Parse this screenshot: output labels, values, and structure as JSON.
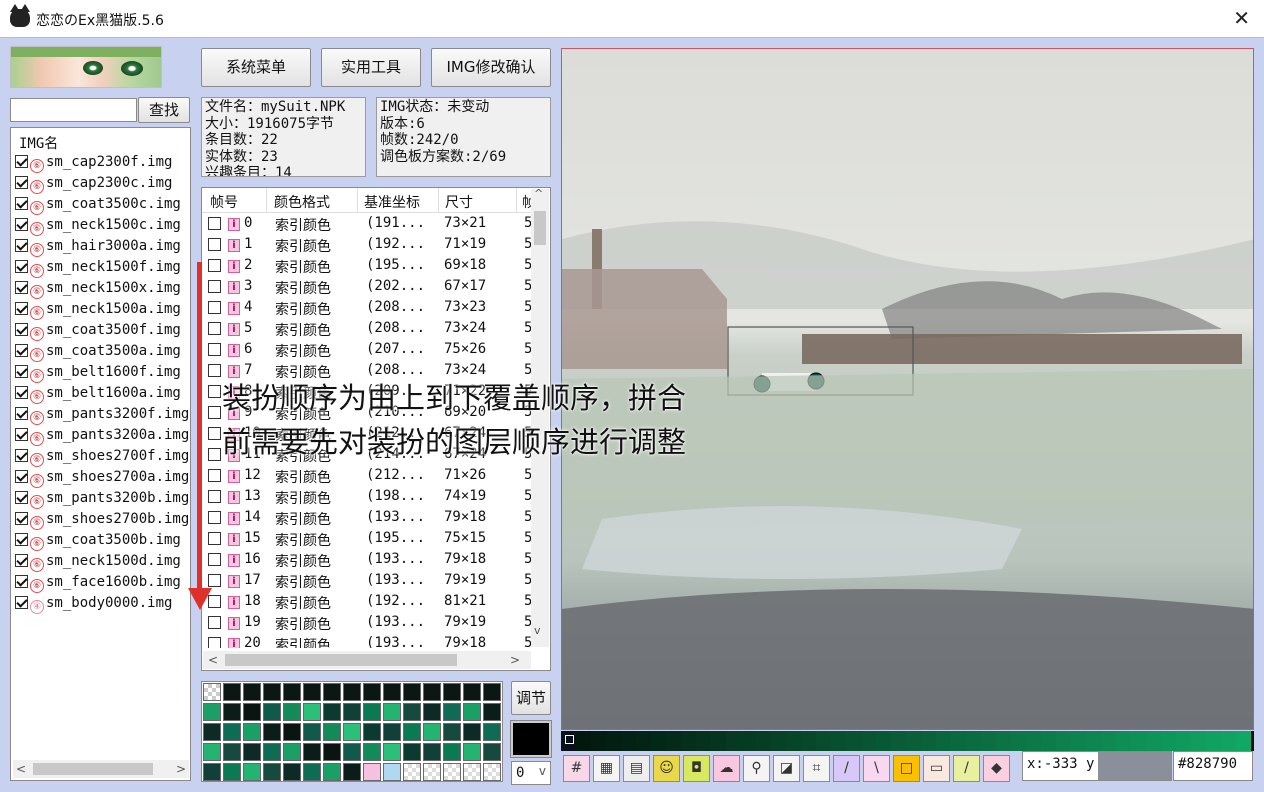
{
  "window": {
    "title": "恋恋のEx黑猫版.5.6",
    "close_glyph": "✕"
  },
  "toolbar": {
    "system_menu": "系统菜单",
    "tools": "实用工具",
    "img_confirm": "IMG修改确认"
  },
  "search": {
    "button": "查找",
    "placeholder": ""
  },
  "file_info": {
    "filename": "文件名：mySuit.NPK",
    "size": "大小：1916075字节",
    "entries": "条目数：22",
    "entities": "实体数：23",
    "fourth": "兴趣条目：14"
  },
  "img_info": {
    "status": "IMG状态：未变动",
    "version": "版本:6",
    "frames": "帧数:242/0",
    "palettes": "调色板方案数:2/69"
  },
  "img_list": {
    "header": "IMG名",
    "items": [
      {
        "name": "sm_cap2300f.img",
        "checked": true,
        "badge": "⑥"
      },
      {
        "name": "sm_cap2300c.img",
        "checked": true,
        "badge": "⑥"
      },
      {
        "name": "sm_coat3500c.img",
        "checked": true,
        "badge": "⑥"
      },
      {
        "name": "sm_neck1500c.img",
        "checked": true,
        "badge": "⑥"
      },
      {
        "name": "sm_hair3000a.img",
        "checked": true,
        "badge": "⑥"
      },
      {
        "name": "sm_neck1500f.img",
        "checked": true,
        "badge": "⑥"
      },
      {
        "name": "sm_neck1500x.img",
        "checked": true,
        "badge": "⑥"
      },
      {
        "name": "sm_neck1500a.img",
        "checked": true,
        "badge": "⑥"
      },
      {
        "name": "sm_coat3500f.img",
        "checked": true,
        "badge": "⑥"
      },
      {
        "name": "sm_coat3500a.img",
        "checked": true,
        "badge": "⑥"
      },
      {
        "name": "sm_belt1600f.img",
        "checked": true,
        "badge": "⑥"
      },
      {
        "name": "sm_belt1600a.img",
        "checked": true,
        "badge": "⑥"
      },
      {
        "name": "sm_pants3200f.img",
        "checked": true,
        "badge": "⑥"
      },
      {
        "name": "sm_pants3200a.img",
        "checked": true,
        "badge": "⑥"
      },
      {
        "name": "sm_shoes2700f.img",
        "checked": true,
        "badge": "⑥"
      },
      {
        "name": "sm_shoes2700a.img",
        "checked": true,
        "badge": "⑥"
      },
      {
        "name": "sm_pants3200b.img",
        "checked": true,
        "badge": "⑥"
      },
      {
        "name": "sm_shoes2700b.img",
        "checked": true,
        "badge": "⑥"
      },
      {
        "name": "sm_coat3500b.img",
        "checked": true,
        "badge": "⑥"
      },
      {
        "name": "sm_neck1500d.img",
        "checked": true,
        "badge": "⑥"
      },
      {
        "name": "sm_face1600b.img",
        "checked": true,
        "badge": "⑥"
      },
      {
        "name": "sm_body0000.img",
        "checked": true,
        "badge": "④"
      }
    ]
  },
  "frame_table": {
    "columns": [
      "帧号",
      "颜色格式",
      "基准坐标",
      "尺寸",
      "帧"
    ],
    "rows": [
      {
        "id": "0",
        "format": "索引颜色",
        "coord": "(191...",
        "size": "73×21",
        "extra": "5"
      },
      {
        "id": "1",
        "format": "索引颜色",
        "coord": "(192...",
        "size": "71×19",
        "extra": "5"
      },
      {
        "id": "2",
        "format": "索引颜色",
        "coord": "(195...",
        "size": "69×18",
        "extra": "5"
      },
      {
        "id": "3",
        "format": "索引颜色",
        "coord": "(202...",
        "size": "67×17",
        "extra": "5"
      },
      {
        "id": "4",
        "format": "索引颜色",
        "coord": "(208...",
        "size": "73×23",
        "extra": "5"
      },
      {
        "id": "5",
        "format": "索引颜色",
        "coord": "(208...",
        "size": "73×24",
        "extra": "5"
      },
      {
        "id": "6",
        "format": "索引颜色",
        "coord": "(207...",
        "size": "75×26",
        "extra": "5"
      },
      {
        "id": "7",
        "format": "索引颜色",
        "coord": "(208...",
        "size": "73×24",
        "extra": "5"
      },
      {
        "id": "8",
        "format": "索引颜色",
        "coord": "(209...",
        "size": "71×22",
        "extra": "5"
      },
      {
        "id": "9",
        "format": "索引颜色",
        "coord": "(210...",
        "size": "69×20",
        "extra": "5"
      },
      {
        "id": "10",
        "format": "索引颜色",
        "coord": "(212...",
        "size": "67×24",
        "extra": "5"
      },
      {
        "id": "11",
        "format": "索引颜色",
        "coord": "(214...",
        "size": "67×24",
        "extra": "5"
      },
      {
        "id": "12",
        "format": "索引颜色",
        "coord": "(212...",
        "size": "71×26",
        "extra": "5"
      },
      {
        "id": "13",
        "format": "索引颜色",
        "coord": "(198...",
        "size": "74×19",
        "extra": "5"
      },
      {
        "id": "14",
        "format": "索引颜色",
        "coord": "(193...",
        "size": "79×18",
        "extra": "5"
      },
      {
        "id": "15",
        "format": "索引颜色",
        "coord": "(195...",
        "size": "75×15",
        "extra": "5"
      },
      {
        "id": "16",
        "format": "索引颜色",
        "coord": "(193...",
        "size": "79×18",
        "extra": "5"
      },
      {
        "id": "17",
        "format": "索引颜色",
        "coord": "(193...",
        "size": "79×19",
        "extra": "5"
      },
      {
        "id": "18",
        "format": "索引颜色",
        "coord": "(192...",
        "size": "81×21",
        "extra": "5"
      },
      {
        "id": "19",
        "format": "索引颜色",
        "coord": "(193...",
        "size": "79×19",
        "extra": "5"
      },
      {
        "id": "20",
        "format": "索引颜色",
        "coord": "(193...",
        "size": "79×18",
        "extra": "5"
      }
    ]
  },
  "palette_panel": {
    "adjust_button": "调节",
    "combo_value": "0",
    "swatch_color": "#000000"
  },
  "annotation": {
    "line1": "装扮顺序为由上到下覆盖顺序，拼合",
    "line2": "前需要先对装扮的图层顺序进行调整"
  },
  "status": {
    "x_label": "x:-333 y",
    "hex": "#828790"
  },
  "tools": [
    "grid-tool-icon",
    "palette-tool-icon",
    "film-tool-icon",
    "frog-tool-icon",
    "camera-tool-icon",
    "cloud-tool-icon",
    "magnifier-tool-icon",
    "layers-tool-icon",
    "crop-tool-icon",
    "pencil-tool-icon",
    "line-tool-icon",
    "rect-tool-icon",
    "eraser-tool-icon",
    "eyedropper-tool-icon",
    "fill-tool-icon"
  ],
  "colors": {
    "accent_red": "#e0302a",
    "canvas_border": "#cc5566",
    "bg": "#c8d2f0"
  }
}
